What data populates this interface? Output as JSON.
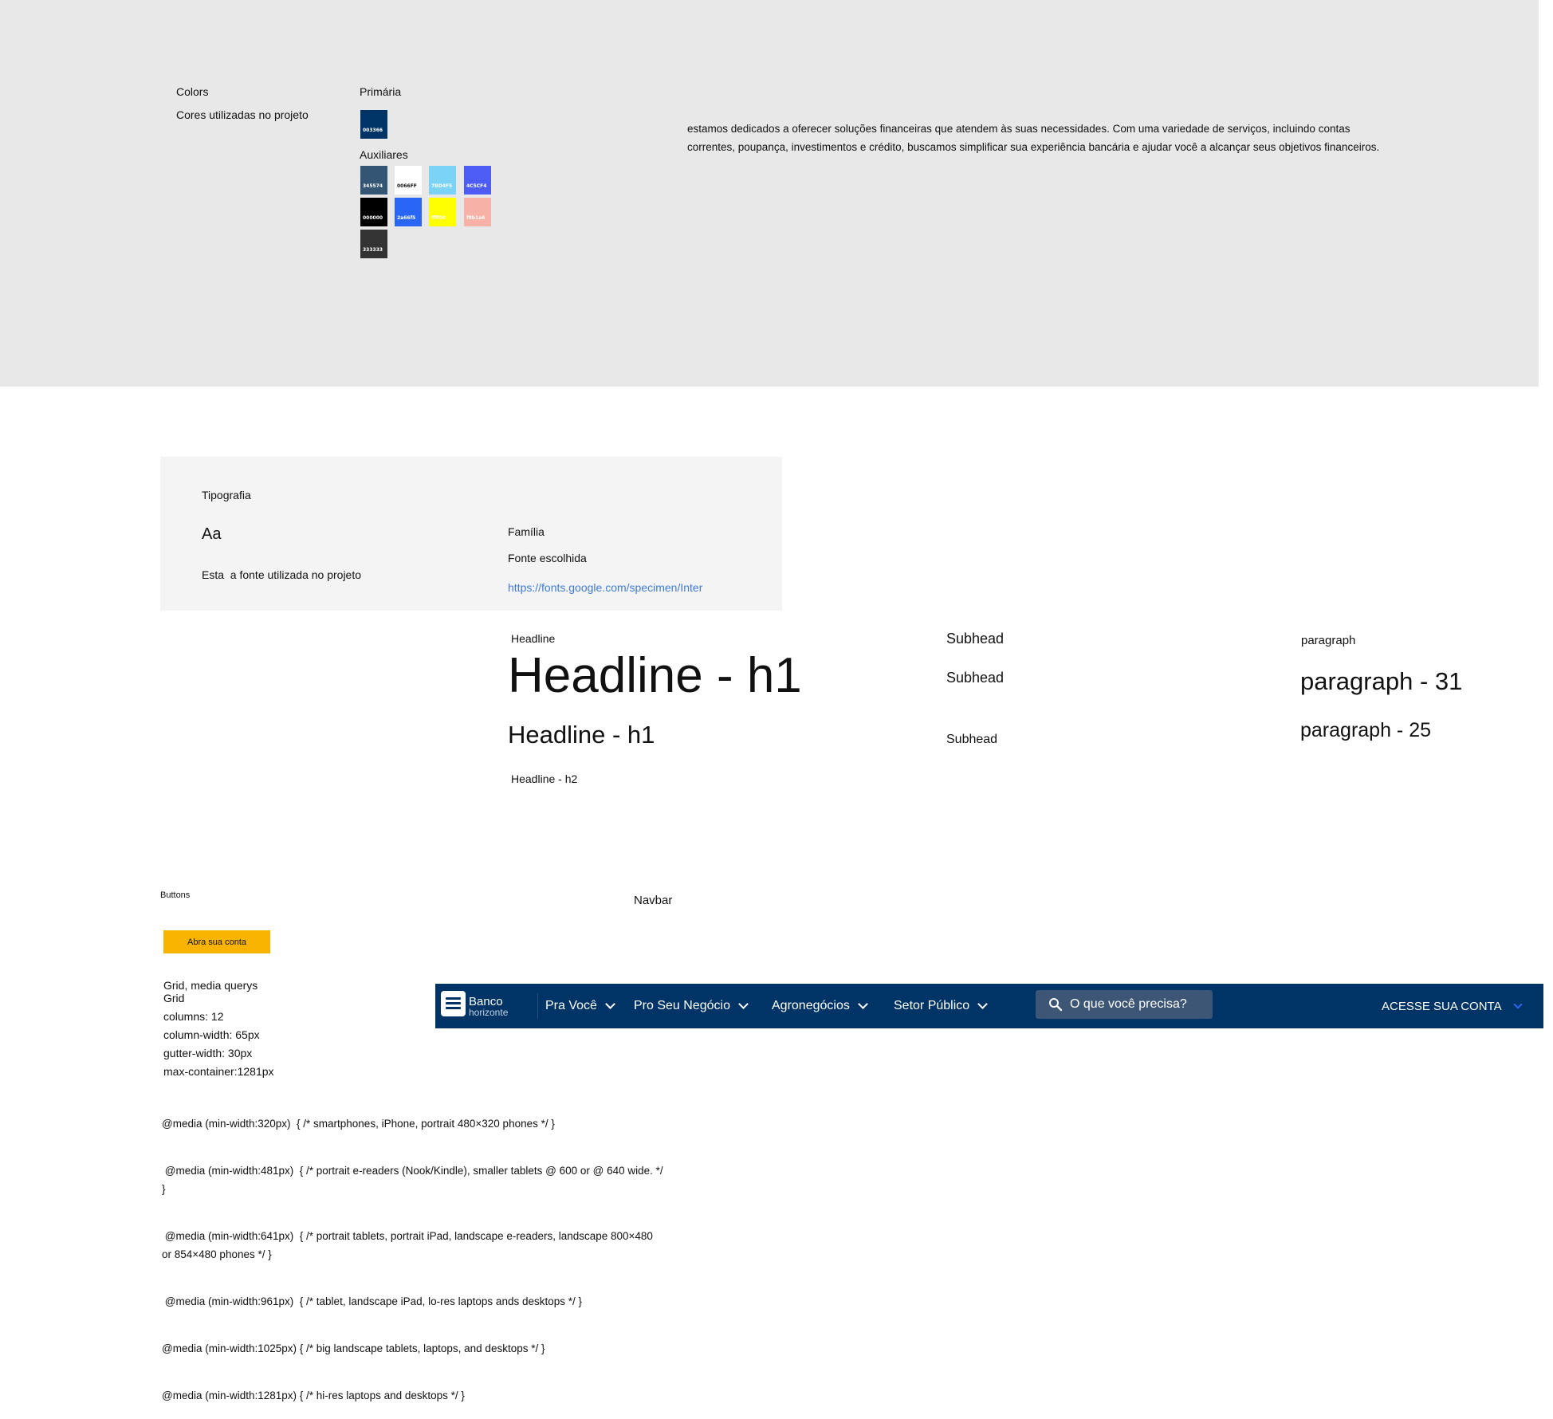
{
  "colors": {
    "title": "Colors",
    "subtitle": "Cores utilizadas no projeto",
    "primary_label": "Primária",
    "primary": {
      "code": "003366",
      "hex": "#003366",
      "text_color": "#ffffff"
    },
    "aux_label": "Auxiliares",
    "aux": [
      {
        "code": "345574",
        "hex": "#345574",
        "text_color": "#ffffff"
      },
      {
        "code": "0066FF",
        "hex": "#ffffff",
        "text_color": "#111111"
      },
      {
        "code": "7BD4F5",
        "hex": "#7bd4f5",
        "text_color": "#ffffff"
      },
      {
        "code": "4C5CF4",
        "hex": "#4c5cf4",
        "text_color": "#ffffff"
      },
      {
        "code": "000000",
        "hex": "#000000",
        "text_color": "#ffffff"
      },
      {
        "code": "2a66f5",
        "hex": "#2a66f5",
        "text_color": "#ffffff"
      },
      {
        "code": "ffff00",
        "hex": "#ffff00",
        "text_color": "#ffffff"
      },
      {
        "code": "f8b1a6",
        "hex": "#f8b1a6",
        "text_color": "#ffffff"
      },
      {
        "code": "333333",
        "hex": "#333333",
        "text_color": "#ffffff"
      }
    ]
  },
  "about": {
    "text": "estamos dedicados a oferecer soluções financeiras que atendem às suas necessidades. Com uma variedade de serviços, incluindo contas correntes, poupança, investimentos e crédito, buscamos simplificar sua experiência bancária e ajudar você a alcançar seus objetivos financeiros."
  },
  "typography": {
    "title": "Tipografia",
    "sample": "Aa",
    "note": "Esta  a fonte utilizada no projeto",
    "family_label": "Família",
    "family_value": "Fonte escolhida",
    "link": "https://fonts.google.com/specimen/Inter"
  },
  "headline": {
    "label": "Headline",
    "h1_large": "Headline - h1",
    "h1_medium": "Headline - h1",
    "h2": "Headline - h2"
  },
  "subhead": {
    "label": "Subhead",
    "sample_1": "Subhead",
    "sample_2": "Subhead"
  },
  "paragraph": {
    "label": "paragraph",
    "p31": "paragraph - 31",
    "p25": "paragraph - 25"
  },
  "buttons": {
    "title": "Buttons",
    "cta_label": "Abra sua conta",
    "cta_color": "#f8b400"
  },
  "navbar_section": {
    "title": "Navbar"
  },
  "grid": {
    "lines": [
      "Grid, media querys",
      "Grid",
      "columns: 12",
      "column-width: 65px",
      "gutter-width: 30px",
      "max-container:1281px"
    ],
    "media": [
      "@media (min-width:320px)  { /* smartphones, iPhone, portrait 480×320 phones */ }",
      " @media (min-width:481px)  { /* portrait e-readers (Nook/Kindle), smaller tablets @ 600 or @ 640 wide. */ }",
      " @media (min-width:641px)  { /* portrait tablets, portrait iPad, landscape e-readers, landscape 800×480 or 854×480 phones */ }",
      " @media (min-width:961px)  { /* tablet, landscape iPad, lo-res laptops ands desktops */ }",
      "@media (min-width:1025px) { /* big landscape tablets, laptops, and desktops */ }",
      "@media (min-width:1281px) { /* hi-res laptops and desktops */ }"
    ]
  },
  "navbar": {
    "brand_line1": "Banco",
    "brand_line2": "horizonte",
    "items": [
      {
        "label": "Pra Você"
      },
      {
        "label": "Pro Seu Negócio"
      },
      {
        "label": "Agronegócios"
      },
      {
        "label": "Setor Público"
      }
    ],
    "search_placeholder": "O que você precisa?",
    "account_label": "ACESSE SUA CONTA",
    "background": "#003366",
    "account_chevron_color": "#2a66f5"
  }
}
